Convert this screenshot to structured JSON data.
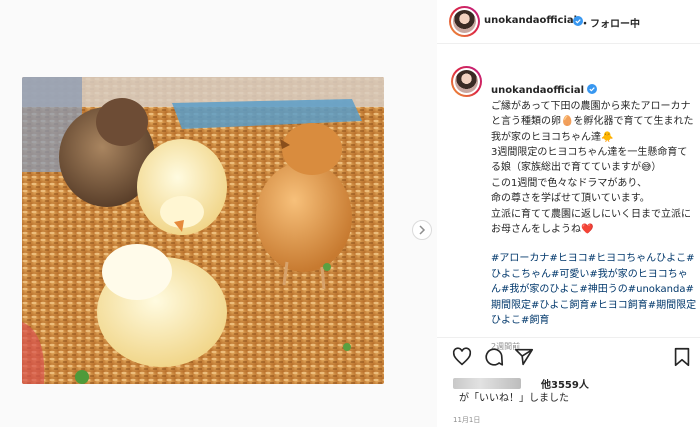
{
  "header": {
    "username": "unokandaofficial",
    "follow_status": "・フォロー中"
  },
  "caption": {
    "username": "unokandaofficial",
    "text": "ご縁があって下田の農園から来たアローカナと言う種類の卵🥚を孵化器で育てて生まれた我が家のヒヨコちゃん達🐥\n3週間限定のヒヨコちゃん達を一生懸命育てる娘（家族総出で育てていますが😅）\nこの1週間で色々なドラマがあり、\n命の尊さを学ばせて頂いています。\n立派に育てて農園に返しにいく日まで立派にお母さんをしようね❤️",
    "hashtags": "#アローカナ#ヒヨコ#ヒヨコちゃんひよこ#ひよこちゃん#可愛い#我が家のヒヨコちゃん#我が家のひよこ#神田うの#unokanda#期間限定#ひよこ飼育#ヒヨコ飼育#期間限定ひよこ#飼育",
    "time_ago": "2週間前"
  },
  "likes": {
    "count_text": "他3559人",
    "liked_text": "が「いいね！」しました"
  },
  "post_date": "11月1日",
  "icons": {
    "verified": "verified-badge-icon",
    "next": "chevron-right-icon",
    "like": "heart-icon",
    "comment": "comment-icon",
    "share": "paper-plane-icon",
    "save": "bookmark-icon"
  },
  "colors": {
    "verified": "#3897f0",
    "link": "#00376b",
    "meta": "#8e8e8e"
  }
}
